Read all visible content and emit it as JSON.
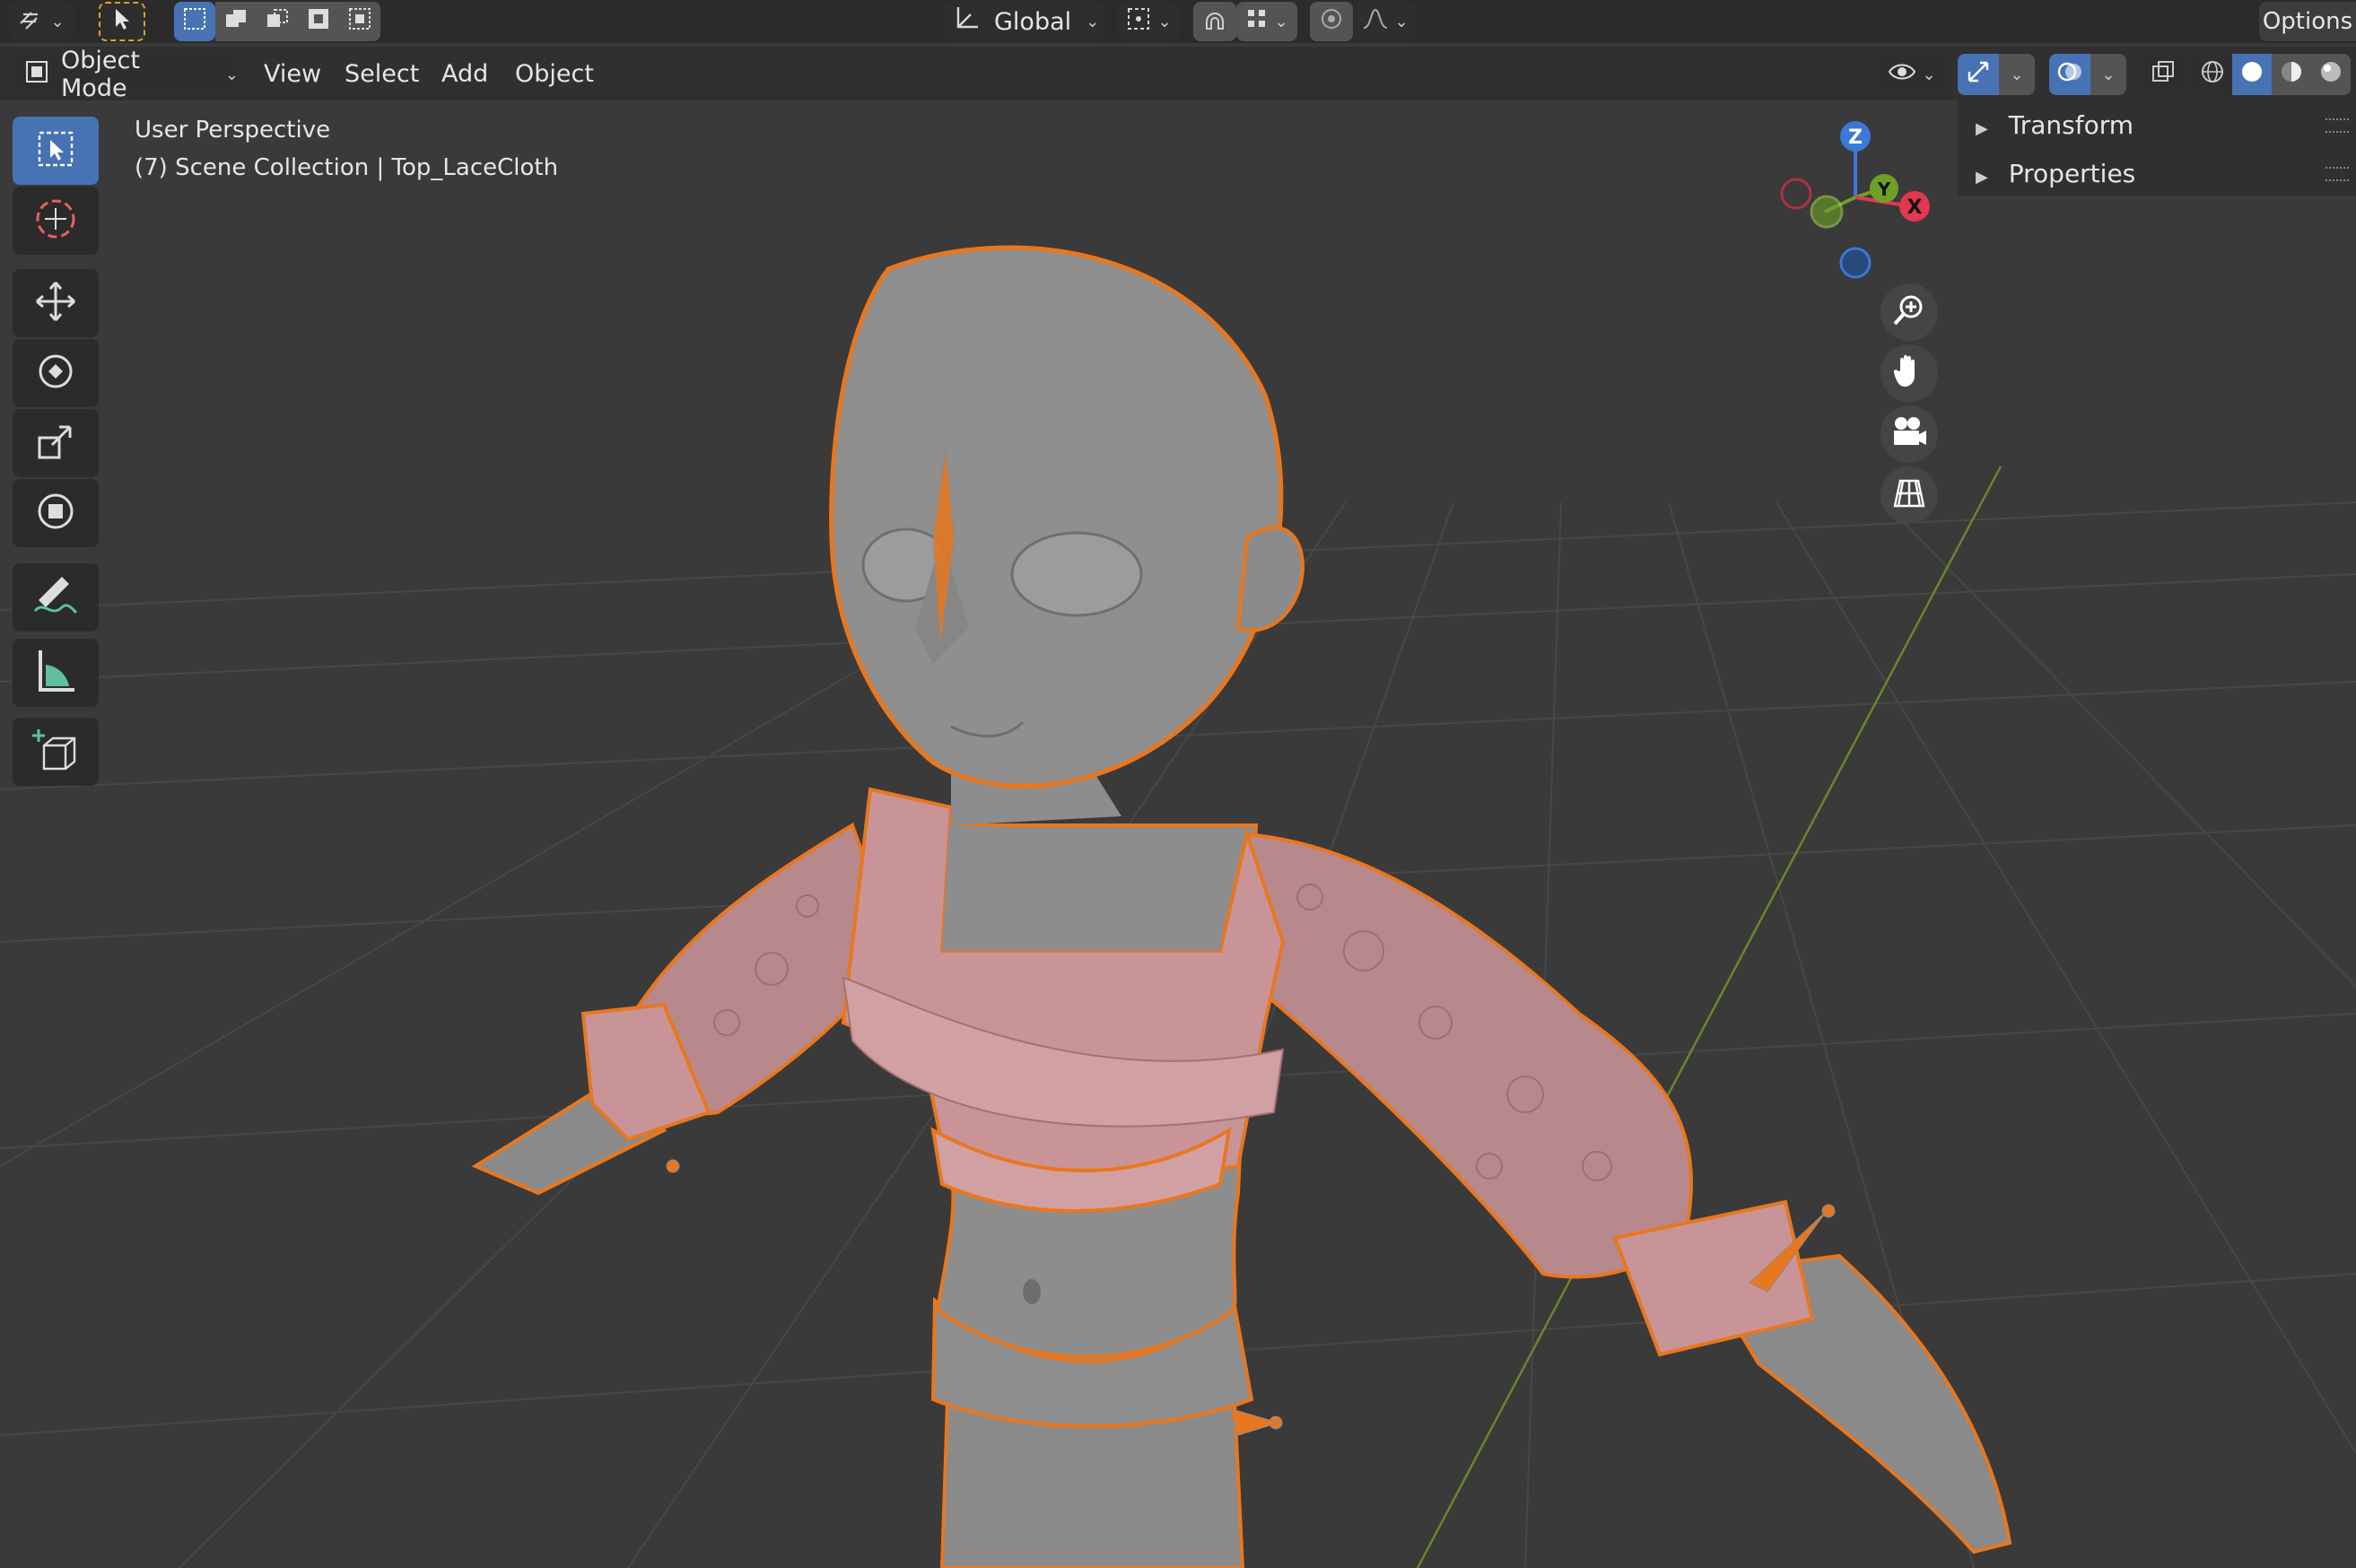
{
  "header": {
    "orientation_label": "Global",
    "options_label": "Options"
  },
  "mode_selector": {
    "label": "Object Mode"
  },
  "menus": {
    "view": "View",
    "select": "Select",
    "add": "Add",
    "object": "Object"
  },
  "viewport_overlay": {
    "view_name": "User Perspective",
    "collection_info": "(7) Scene Collection | Top_LaceCloth"
  },
  "gizmo": {
    "z": "Z",
    "y": "Y",
    "x": "X"
  },
  "sidebar_panels": {
    "transform": "Transform",
    "properties": "Properties"
  },
  "tools": [
    "tweak-select",
    "cursor",
    "move",
    "rotate",
    "scale",
    "transform",
    "annotate",
    "measure",
    "add-cube"
  ],
  "colors": {
    "accent_blue": "#4772b3",
    "selection_outline": "#e8771f",
    "cloth_pink": "#c99497",
    "body_gray": "#8c8c8c",
    "axis_x_red": "#e0384f",
    "axis_y_green": "#6da126",
    "axis_z_blue": "#3b78d8"
  }
}
